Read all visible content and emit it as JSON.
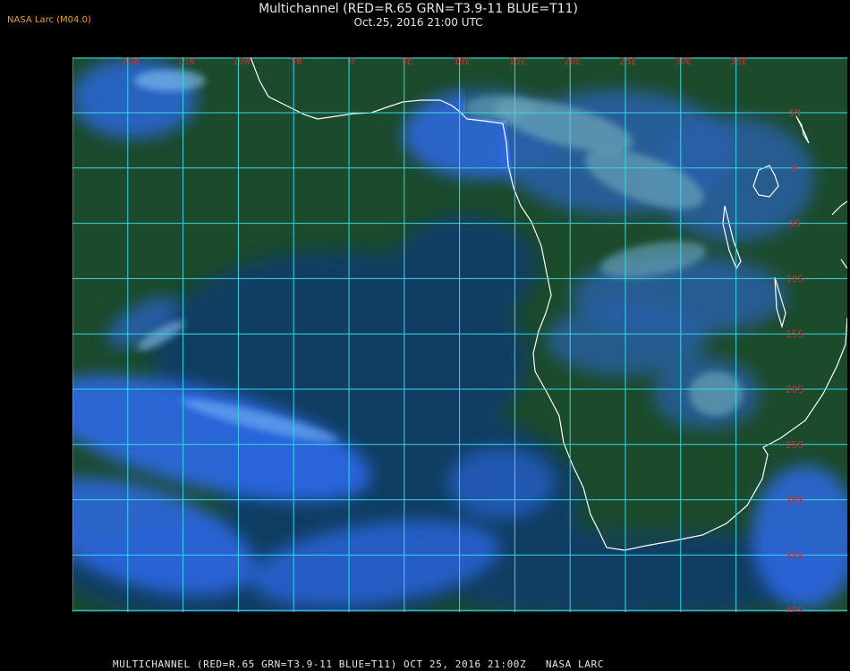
{
  "header": {
    "logo": "NASA Larc (M04.0)",
    "title": "Multichannel (RED=R.65 GRN=T3.9-11 BLUE=T11)",
    "subtitle": "Oct.25, 2016 21:00 UTC"
  },
  "map": {
    "longitude_labels": [
      "25W",
      "20W",
      "15W",
      "10W",
      "5W",
      "0",
      "5E",
      "10E",
      "15E",
      "20E",
      "25E",
      "30E",
      "35E"
    ],
    "latitude_labels": [
      "5N",
      "0",
      "5S",
      "10S",
      "15S",
      "20S",
      "25S",
      "30S",
      "35S",
      "40S"
    ],
    "colors": {
      "ocean": "#1b4a2c",
      "deep_ocean": "#0f3a74",
      "cloud": "#2e6bf0",
      "high_cloud": "#8fd0ff",
      "grid": "#38d8e8",
      "grid_label": "#c2322e",
      "coastline": "#ffffff",
      "logo": "#e8a33a"
    }
  },
  "footer": {
    "caption": "MULTICHANNEL (RED=R.65 GRN=T3.9-11 BLUE=T11) OCT 25, 2016 21:00Z   NASA LARC"
  }
}
